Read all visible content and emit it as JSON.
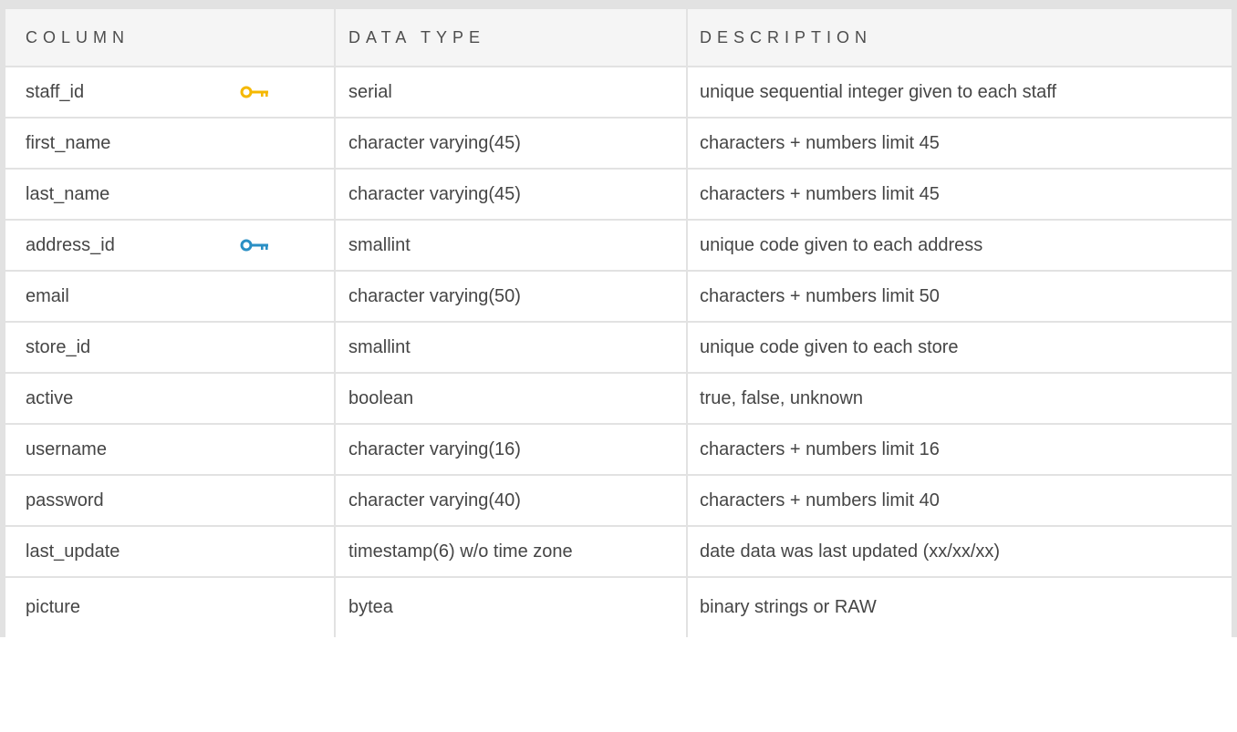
{
  "colors": {
    "primary_key": "#f5b800",
    "foreign_key": "#2a8fc4",
    "border": "#e2e2e2",
    "header_bg": "#f5f5f5"
  },
  "headers": {
    "column": "COLUMN",
    "data_type": "DATA TYPE",
    "description": "DESCRIPTION"
  },
  "rows": [
    {
      "column": "staff_id",
      "data_type": "serial",
      "description": "unique sequential integer given to each staff",
      "key": "primary-key-icon"
    },
    {
      "column": "first_name",
      "data_type": "character varying(45)",
      "description": "characters + numbers limit 45"
    },
    {
      "column": "last_name",
      "data_type": "character varying(45)",
      "description": "characters + numbers limit 45"
    },
    {
      "column": "address_id",
      "data_type": "smallint",
      "description": "unique code given to each address",
      "key": "foreign-key-icon"
    },
    {
      "column": "email",
      "data_type": "character varying(50)",
      "description": "characters + numbers limit 50"
    },
    {
      "column": "store_id",
      "data_type": "smallint",
      "description": "unique code given to each store"
    },
    {
      "column": "active",
      "data_type": "boolean",
      "description": "true, false, unknown"
    },
    {
      "column": "username",
      "data_type": "character varying(16)",
      "description": "characters + numbers limit 16"
    },
    {
      "column": "password",
      "data_type": "character varying(40)",
      "description": "characters + numbers limit 40"
    },
    {
      "column": "last_update",
      "data_type": "timestamp(6) w/o time zone",
      "description": "date data was last updated (xx/xx/xx)"
    },
    {
      "column": "picture",
      "data_type": "bytea",
      "description": "binary strings or RAW"
    }
  ]
}
